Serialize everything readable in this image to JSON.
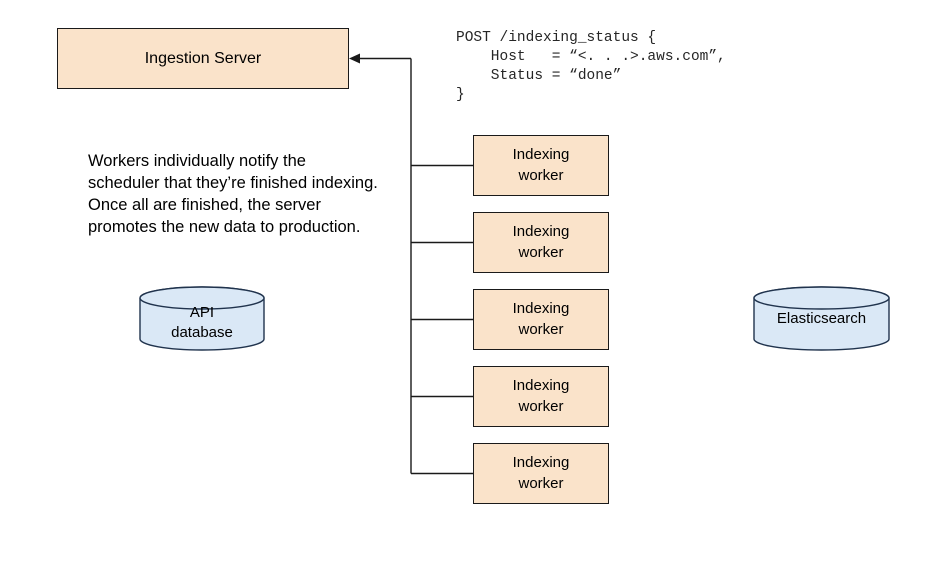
{
  "diagram": {
    "title_node": {
      "id": "ingestion-server",
      "label": "Ingestion Server",
      "shape": "rectangle",
      "fill": "#fae3ca",
      "stroke": "#1a1a1a"
    },
    "workers": [
      {
        "id": "worker-1",
        "label": "Indexing\nworker"
      },
      {
        "id": "worker-2",
        "label": "Indexing\nworker"
      },
      {
        "id": "worker-3",
        "label": "Indexing\nworker"
      },
      {
        "id": "worker-4",
        "label": "Indexing\nworker"
      },
      {
        "id": "worker-5",
        "label": "Indexing\nworker"
      }
    ],
    "datastores": [
      {
        "id": "api-database",
        "label": "API\ndatabase",
        "shape": "cylinder",
        "fill": "#dae8f6",
        "stroke": "#20334d"
      },
      {
        "id": "elasticsearch",
        "label": "Elasticsearch",
        "shape": "cylinder",
        "fill": "#dae8f6",
        "stroke": "#20334d"
      }
    ],
    "description": "Workers individually notify the scheduler that they’re finished indexing. Once all are finished, the server promotes the new data to production.",
    "request_snippet": "POST /indexing_status {\n    Host   = “<. . .>.aws.com”,\n    Status = “done”\n}",
    "edge": {
      "name": "workers-to-ingestion-server",
      "direction": "to-ingestion-server",
      "arrowhead": "solid-triangle-left"
    },
    "colors": {
      "box_fill": "#fae3ca",
      "box_stroke": "#1a1a1a",
      "cylinder_fill": "#dae8f6",
      "cylinder_stroke": "#20334d",
      "connector_stroke": "#1a1a1a",
      "background": "#ffffff",
      "code_text": "#262626"
    }
  }
}
